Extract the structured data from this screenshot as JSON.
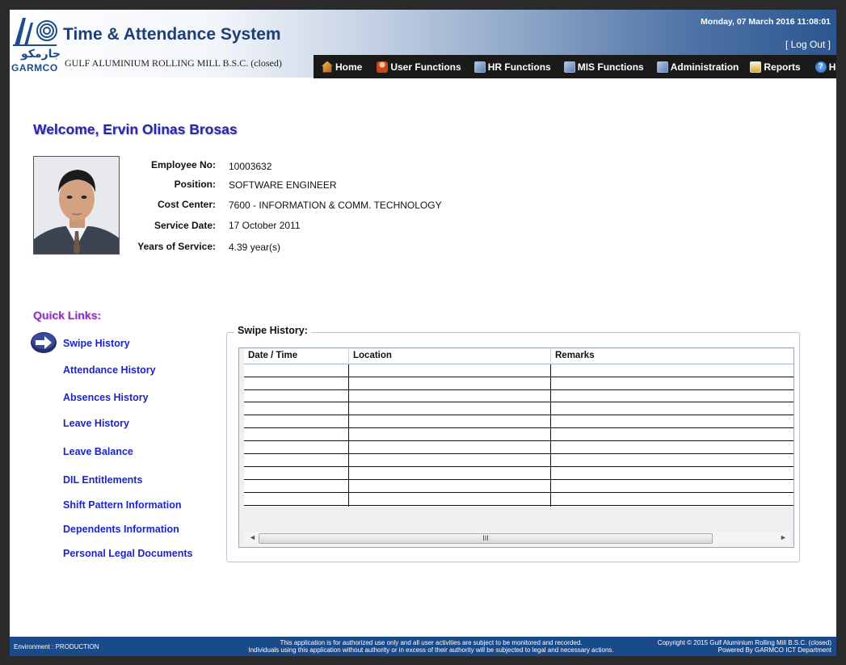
{
  "header": {
    "logo_text": "GARMCO",
    "logo_text_ar": "جارمكو",
    "app_title": "Time & Attendance System",
    "company_name": "GULF ALUMINIUM ROLLING MILL B.S.C. (closed)",
    "datetime": "Monday, 07 March 2016 11:08:01",
    "logout_label": "[ Log Out ]"
  },
  "nav": {
    "items": [
      {
        "label": "Home",
        "icon": "home-icon"
      },
      {
        "label": "User Functions",
        "icon": "user-icon"
      },
      {
        "label": "HR Functions",
        "icon": "hr-icon"
      },
      {
        "label": "MIS Functions",
        "icon": "mis-icon"
      },
      {
        "label": "Administration",
        "icon": "admin-icon"
      },
      {
        "label": "Reports",
        "icon": "reports-icon"
      },
      {
        "label": "Help",
        "icon": "help-icon"
      }
    ]
  },
  "welcome": "Welcome, Ervin Olinas Brosas",
  "employee": {
    "labels": {
      "emp_no": "Employee No:",
      "position": "Position:",
      "cost_center": "Cost Center:",
      "service_date": "Service Date:",
      "years": "Years of Service:"
    },
    "values": {
      "emp_no": "10003632",
      "position": "SOFTWARE ENGINEER",
      "cost_center": "7600 - INFORMATION & COMM. TECHNOLOGY",
      "service_date": "17 October 2011",
      "years": "4.39 year(s)"
    }
  },
  "quick_links": {
    "title": "Quick Links:",
    "items": [
      "Swipe History",
      "Attendance History",
      "Absences History",
      "Leave History",
      "Leave Balance",
      "DIL Entitlements",
      "Shift Pattern Information",
      "Dependents Information",
      "Personal Legal Documents"
    ]
  },
  "swipe_history": {
    "title": "Swipe History:",
    "columns": [
      "Date / Time",
      "Location",
      "Remarks"
    ],
    "rows": [],
    "scroll_grip": "III"
  },
  "footer": {
    "environment": "Environment : PRODUCTION",
    "notice_line1": "This application is for authorized use only and all user activities are subject to be monitored and recorded.",
    "notice_line2": "Individuals using this application without authority or in excess of their authority will be subjected to legal and necessary actions.",
    "copyright": "Copyright © 2015 Gulf Aluminium Rolling Mill B.S.C. (closed)",
    "powered": "Powered By GARMCO ICT Department"
  }
}
